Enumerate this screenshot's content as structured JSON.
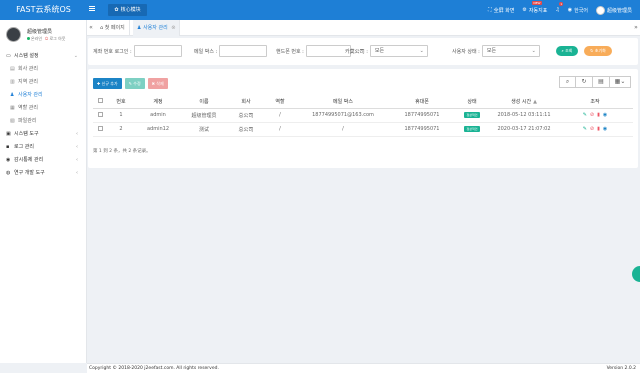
{
  "app": {
    "title": "FAST云系统OS",
    "module_tab": "核心模块"
  },
  "topbar": {
    "fullscreen": "全屏 화면",
    "notifications": "자동지표",
    "new_badge": "NEW",
    "messages_count": "1",
    "language": "한국어",
    "admin_name": "超级管理员"
  },
  "user": {
    "name": "超级管理员",
    "online": "온라인",
    "logout": "로그 아웃"
  },
  "sidebar": {
    "groups": [
      {
        "label": "시스템 설정",
        "expanded": true,
        "items": [
          {
            "label": "회사 관리",
            "icon": "building-icon"
          },
          {
            "label": "지역 관리",
            "icon": "map-icon"
          },
          {
            "label": "사용자 관리",
            "icon": "user-icon",
            "active": true
          },
          {
            "label": "역할 관리",
            "icon": "role-icon"
          },
          {
            "label": "파일관리",
            "icon": "file-icon"
          }
        ]
      },
      {
        "label": "시스템 도구",
        "expanded": false
      },
      {
        "label": "로그 관리",
        "expanded": false
      },
      {
        "label": "감시통제 관리",
        "expanded": false
      },
      {
        "label": "연구 개발 도구",
        "expanded": false
      }
    ]
  },
  "tabs": [
    {
      "label": "첫 페이지",
      "icon": "home-icon"
    },
    {
      "label": "사용자 관리",
      "icon": "user-icon",
      "active": true
    }
  ],
  "search": {
    "account_label": "계좌 번호 로그인 :",
    "email_label": "메일 박스 :",
    "phone_label": "핸드폰 번호 :",
    "company_label": "카莫公司 :",
    "company_value": "모든",
    "status_label": "사용자 상태 :",
    "status_value": "모든",
    "search_button": "조회",
    "reset_button": "초기화"
  },
  "toolbar": {
    "add": "신규 추가",
    "edit": "수정",
    "delete": "삭제"
  },
  "table": {
    "headers": [
      "번호",
      "계정",
      "이름",
      "회사",
      "역할",
      "메일 박스",
      "휴대폰",
      "상태",
      "생성 시간",
      "조작"
    ],
    "rows": [
      {
        "no": "1",
        "account": "admin",
        "name": "超级管理员",
        "company": "总公司",
        "role": "/",
        "email": "18774995071@163.com",
        "phone": "18774995071",
        "status": "정상적인",
        "created": "2018-05-12 03:11:11"
      },
      {
        "no": "2",
        "account": "admin12",
        "name": "测试",
        "company": "总公司",
        "role": "/",
        "email": "/",
        "phone": "18774995071",
        "status": "정상적인",
        "created": "2020-03-17 21:07:02"
      }
    ],
    "pagination": "第 1 到 2 条，共 2 条记录。"
  },
  "footer": {
    "copyright": "Copyright © 2018-2020 j2eefast.com. All rights reserved.",
    "version": "Version 2.0.2"
  },
  "colors": {
    "primary": "#1e7fd6",
    "success": "#1ab394",
    "warning": "#f8ac59",
    "danger": "#ed5565"
  }
}
